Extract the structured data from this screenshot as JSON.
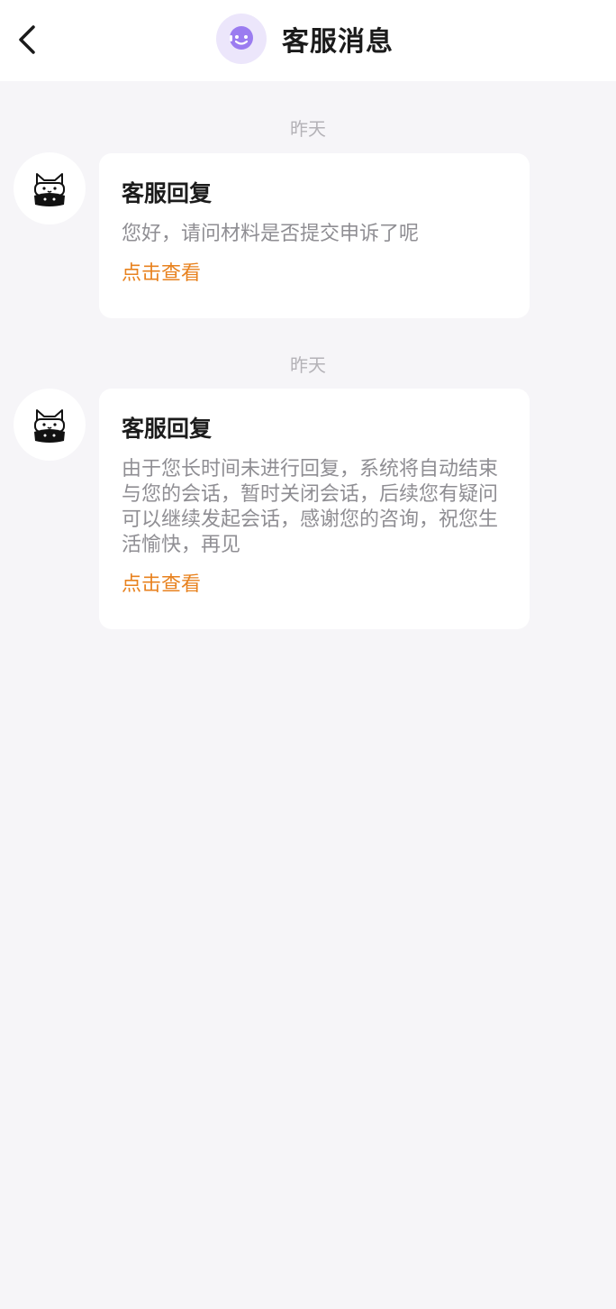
{
  "header": {
    "back_icon": "chevron-left-icon",
    "title_icon": "customer-service-icon",
    "title": "客服消息"
  },
  "messages": [
    {
      "date": "昨天",
      "avatar_icon": "cat-avatar-icon",
      "title": "客服回复",
      "body": "您好，请问材料是否提交申诉了呢",
      "link": "点击查看"
    },
    {
      "date": "昨天",
      "avatar_icon": "cat-avatar-icon",
      "title": "客服回复",
      "body": "由于您长时间未进行回复，系统将自动结束与您的会话，暂时关闭会话，后续您有疑问可以继续发起会话，感谢您的咨询，祝您生活愉快，再见",
      "link": "点击查看"
    }
  ],
  "colors": {
    "background": "#f6f5f8",
    "link": "#e8821f",
    "icon_bg": "#ece6fb",
    "icon_fg": "#9b7cf0"
  }
}
